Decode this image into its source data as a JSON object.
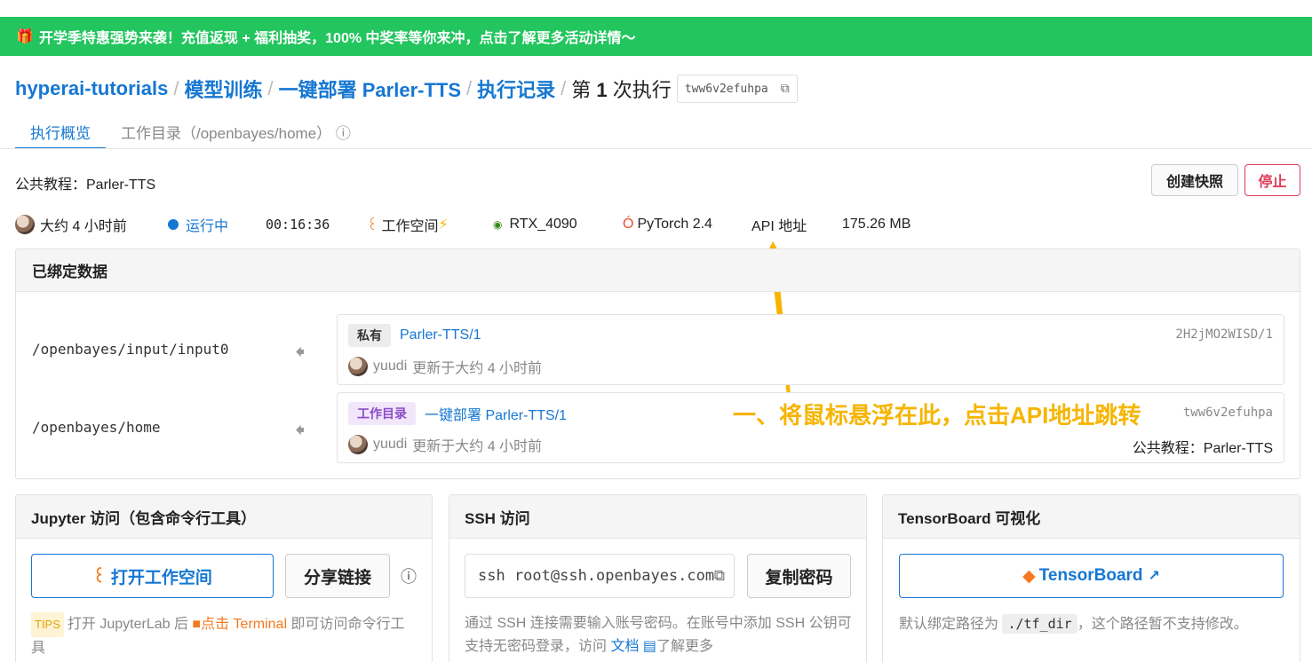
{
  "banner": {
    "icon": "gift-icon",
    "text": "开学季特惠强势来袭！充值返现 + 福利抽奖，100% 中奖率等你来冲，点击了解更多活动详情～"
  },
  "breadcrumb": {
    "items": [
      "hyperai-tutorials",
      "模型训练",
      "一键部署 Parler-TTS",
      "执行记录"
    ],
    "current_prefix": "第",
    "current_num": "1",
    "current_suffix": "次执行",
    "id": "tww6v2efuhpa"
  },
  "tabs": [
    {
      "label": "执行概览",
      "active": true
    },
    {
      "label": "工作目录（/openbayes/home）",
      "active": false
    }
  ],
  "header": {
    "public_tutorial": "公共教程：Parler-TTS",
    "snapshot_button": "创建快照",
    "stop_button": "停止"
  },
  "status": {
    "created": "大约 4 小时前",
    "state": "运行中",
    "elapsed": "00:16:36",
    "workspace": "工作空间",
    "gpu": "RTX_4090",
    "framework": "PyTorch 2.4",
    "api": "API 地址",
    "size": "175.26 MB"
  },
  "bound_data": {
    "title": "已绑定数据",
    "rows": [
      {
        "path": "/openbayes/input/input0",
        "tag": "私有",
        "name": "Parler-TTS/1",
        "id": "2H2jMO2WISD/1",
        "user": "yuudi",
        "updated": "更新于大约 4 小时前",
        "extra": ""
      },
      {
        "path": "/openbayes/home",
        "tag": "工作目录",
        "name": "一键部署 Parler-TTS/1",
        "id": "tww6v2efuhpa",
        "user": "yuudi",
        "updated": "更新于大约 4 小时前",
        "extra": "公共教程：Parler-TTS"
      }
    ]
  },
  "annotation": "一、将鼠标悬浮在此，点击API地址跳转",
  "jupyter": {
    "title": "Jupyter 访问（包含命令行工具）",
    "open_button": "打开工作空间",
    "share_button": "分享链接",
    "tips": "TIPS",
    "text1": "打开 JupyterLab 后",
    "text2": "点击 Terminal",
    "text3": "即可访问命令行工具"
  },
  "ssh": {
    "title": "SSH 访问",
    "command": "ssh root@ssh.openbayes.com",
    "copy_button": "复制密码",
    "text1": "通过 SSH 连接需要输入账号密码。在账号中添加 SSH 公钥可支持无密码登录，访问",
    "doc_link": "文档",
    "text2": "了解更多"
  },
  "tensorboard": {
    "title": "TensorBoard 可视化",
    "button": "TensorBoard",
    "text1": "默认绑定路径为",
    "path": "./tf_dir",
    "text2": "，这个路径暂不支持修改。"
  },
  "colors": {
    "banner": "#22c55e",
    "link": "#1677d2",
    "annotation": "#f6b500",
    "stop": "#e03b5a"
  }
}
